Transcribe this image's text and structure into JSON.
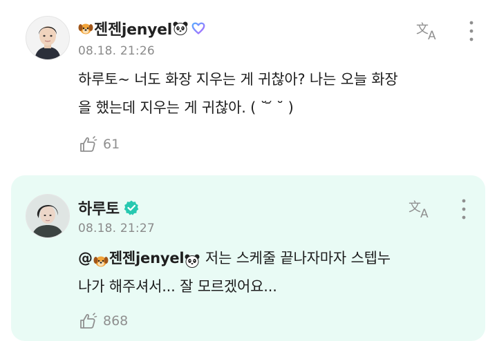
{
  "comment": {
    "author": "젠젠jenyel",
    "timestamp": "08.18. 21:26",
    "text_line1": "하루토~ 너도 화장 지우는 게 귀찮아? 나는 오늘 화장",
    "text_line2": "을 했는데 지우는 게 귀찮아. ( ˘ ᷄ ˘ )",
    "like_count": "61"
  },
  "reply": {
    "author": "하루토",
    "timestamp": "08.18. 21:27",
    "mention_at": "@",
    "mention_name": "젠젠jenyel",
    "text_line1_rest": " 저는 스케줄 끝나자마자 스텝누",
    "text_line2": "나가 해주셔서... 잘 모르겠어요...",
    "like_count": "868"
  },
  "icons": {
    "dog": "dog-emoji",
    "panda": "panda-emoji",
    "heart": "heart-outline-icon",
    "verified": "verified-badge-icon",
    "translate": "translate-icon",
    "more": "more-vertical-icon",
    "like": "like-hand-icon"
  },
  "colors": {
    "reply_background": "#e9fbf5",
    "verified": "#27c8b0",
    "heart_gradient_start": "#5aa9ff",
    "heart_gradient_end": "#b06bff"
  }
}
